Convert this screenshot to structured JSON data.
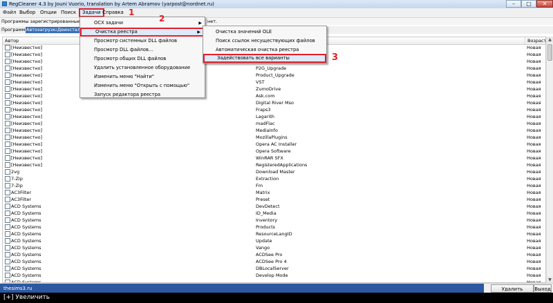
{
  "window": {
    "title": "RegCleaner 4.3 by Jouni Vuorio, translation by Artem Abramov (yarpost@nordnet.ru)",
    "min_glyph": "–",
    "max_glyph": "□",
    "close_glyph": "✕"
  },
  "menubar": {
    "items": [
      "Файл",
      "Выбор",
      "Опции",
      "Поиск",
      "Задачи",
      "Справка"
    ]
  },
  "info": {
    "left": "Программы зарегистрированные в р",
    "right": "нет."
  },
  "tabs": [
    "Программы",
    "Автозагрузка",
    "Деинстал"
  ],
  "table": {
    "headers": {
      "author": "Автор",
      "age": "Возраст"
    },
    "rows": [
      {
        "author": "[Неизвестно]",
        "name": "",
        "age": "Новая"
      },
      {
        "author": "[Неизвестно]",
        "name": "",
        "age": "Новая"
      },
      {
        "author": "[Неизвестно]",
        "name": "",
        "age": "Новая"
      },
      {
        "author": "[Неизвестно]",
        "name": "P2G_Upgrade",
        "age": "Новая"
      },
      {
        "author": "[Неизвестно]",
        "name": "Product_Upgrade",
        "age": "Новая"
      },
      {
        "author": "[Неизвестно]",
        "name": "VST",
        "age": "Новая"
      },
      {
        "author": "[Неизвестно]",
        "name": "ZumoDrive",
        "age": "Новая"
      },
      {
        "author": "[Неизвестно]",
        "name": "Ask.com",
        "age": "Новая"
      },
      {
        "author": "[Неизвестно]",
        "name": "Digital River Mso",
        "age": "Новая"
      },
      {
        "author": "[Неизвестно]",
        "name": "Fraps3",
        "age": "Новая"
      },
      {
        "author": "[Неизвестно]",
        "name": "Lagarith",
        "age": "Новая"
      },
      {
        "author": "[Неизвестно]",
        "name": "madFlac",
        "age": "Новая"
      },
      {
        "author": "[Неизвестно]",
        "name": "MediaInfo",
        "age": "Новая"
      },
      {
        "author": "[Неизвестно]",
        "name": "MozillaPlugins",
        "age": "Новая"
      },
      {
        "author": "[Неизвестно]",
        "name": "Opera AC Installer",
        "age": "Новая"
      },
      {
        "author": "[Неизвестно]",
        "name": "Opera Software",
        "age": "Новая"
      },
      {
        "author": "[Неизвестно]",
        "name": "WinRAR SFX",
        "age": "Новая"
      },
      {
        "author": "[Неизвестно]",
        "name": "RegisteredApplications",
        "age": "Новая"
      },
      {
        "author": "2vg",
        "name": "Download Master",
        "age": "Новая"
      },
      {
        "author": "7-Zip",
        "name": "Extraction",
        "age": "Новая"
      },
      {
        "author": "7-Zip",
        "name": "Fm",
        "age": "Новая"
      },
      {
        "author": "AC3Filter",
        "name": "Matrix",
        "age": "Новая"
      },
      {
        "author": "AC3Filter",
        "name": "Preset",
        "age": "Новая"
      },
      {
        "author": "ACD Systems",
        "name": "DevDetect",
        "age": "Новая"
      },
      {
        "author": "ACD Systems",
        "name": "ID_Media",
        "age": "Новая"
      },
      {
        "author": "ACD Systems",
        "name": "Inventory",
        "age": "Новая"
      },
      {
        "author": "ACD Systems",
        "name": "Products",
        "age": "Новая"
      },
      {
        "author": "ACD Systems",
        "name": "ResourceLangID",
        "age": "Новая"
      },
      {
        "author": "ACD Systems",
        "name": "Update",
        "age": "Новая"
      },
      {
        "author": "ACD Systems",
        "name": "Vango",
        "age": "Новая"
      },
      {
        "author": "ACD Systems",
        "name": "ACDSee Pro",
        "age": "Новая"
      },
      {
        "author": "ACD Systems",
        "name": "ACDSee Pro 4",
        "age": "Новая"
      },
      {
        "author": "ACD Systems",
        "name": "DBLocalServer",
        "age": "Новая"
      },
      {
        "author": "ACD Systems",
        "name": "Develop Mode",
        "age": "Новая"
      },
      {
        "author": "ACD Systems",
        "name": "",
        "age": "Новая"
      }
    ]
  },
  "menu1": {
    "items": [
      {
        "label": "ОСХ задачи",
        "submenu": true
      },
      {
        "label": "Очистка реестра",
        "submenu": true
      },
      {
        "label": "Просмотр системных DLL файлов",
        "submenu": false
      },
      {
        "label": "Просмотр DLL файлов...",
        "submenu": false
      },
      {
        "label": "Просмотр общих DLL файлов",
        "submenu": false
      },
      {
        "label": "Удалить установленное оборудование",
        "submenu": false
      },
      {
        "label": "Изменить меню \"Найти\"",
        "submenu": false
      },
      {
        "label": "Изменить меню \"Открыть с помощью\"",
        "submenu": false
      },
      {
        "label": "Запуск редактора реестра",
        "submenu": false
      }
    ],
    "submenu_arrow": "▶"
  },
  "menu2": {
    "items": [
      "Очистка значений OLE",
      "Поиск ссылок несуществующих файлов",
      "Автоматическая очистка реестра",
      "Задействовать все варианты"
    ]
  },
  "annotations": [
    "1",
    "2",
    "3"
  ],
  "statusbar": {
    "site": "thesims3.ru",
    "delete_label": "Удалить",
    "exit_label": "Выход"
  },
  "zoombar": {
    "label": "[+] Увеличить"
  },
  "scrollbar": {
    "up_glyph": "▲",
    "down_glyph": "▼"
  },
  "colors": {
    "highlight_box": "#e0202a",
    "status_blue": "#2c58a0"
  }
}
